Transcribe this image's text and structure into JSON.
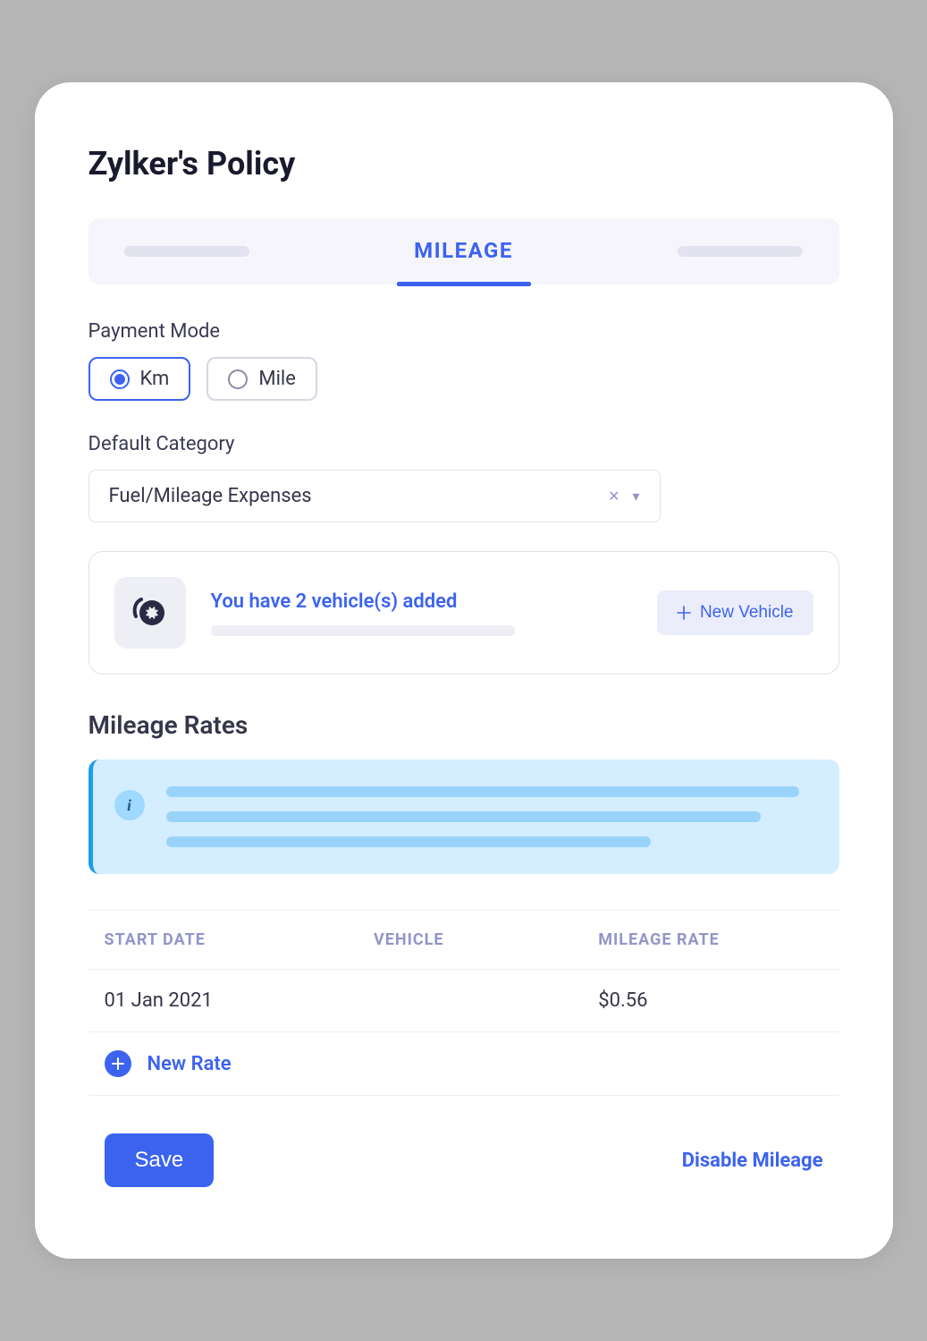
{
  "page": {
    "title": "Zylker's Policy"
  },
  "tabs": {
    "active": "MILEAGE"
  },
  "payment_mode": {
    "label": "Payment Mode",
    "options": {
      "km": "Km",
      "mile": "Mile"
    },
    "selected": "km"
  },
  "default_category": {
    "label": "Default Category",
    "value": "Fuel/Mileage Expenses"
  },
  "vehicles": {
    "heading": "You have 2 vehicle(s) added",
    "new_label": "New Vehicle"
  },
  "mileage_rates": {
    "heading": "Mileage Rates",
    "columns": {
      "start_date": "START DATE",
      "vehicle": "VEHICLE",
      "rate": "MILEAGE RATE"
    },
    "rows": [
      {
        "start_date": "01 Jan 2021",
        "vehicle": "",
        "rate": "$0.56"
      }
    ],
    "new_rate_label": "New Rate"
  },
  "actions": {
    "save": "Save",
    "disable": "Disable Mileage"
  }
}
